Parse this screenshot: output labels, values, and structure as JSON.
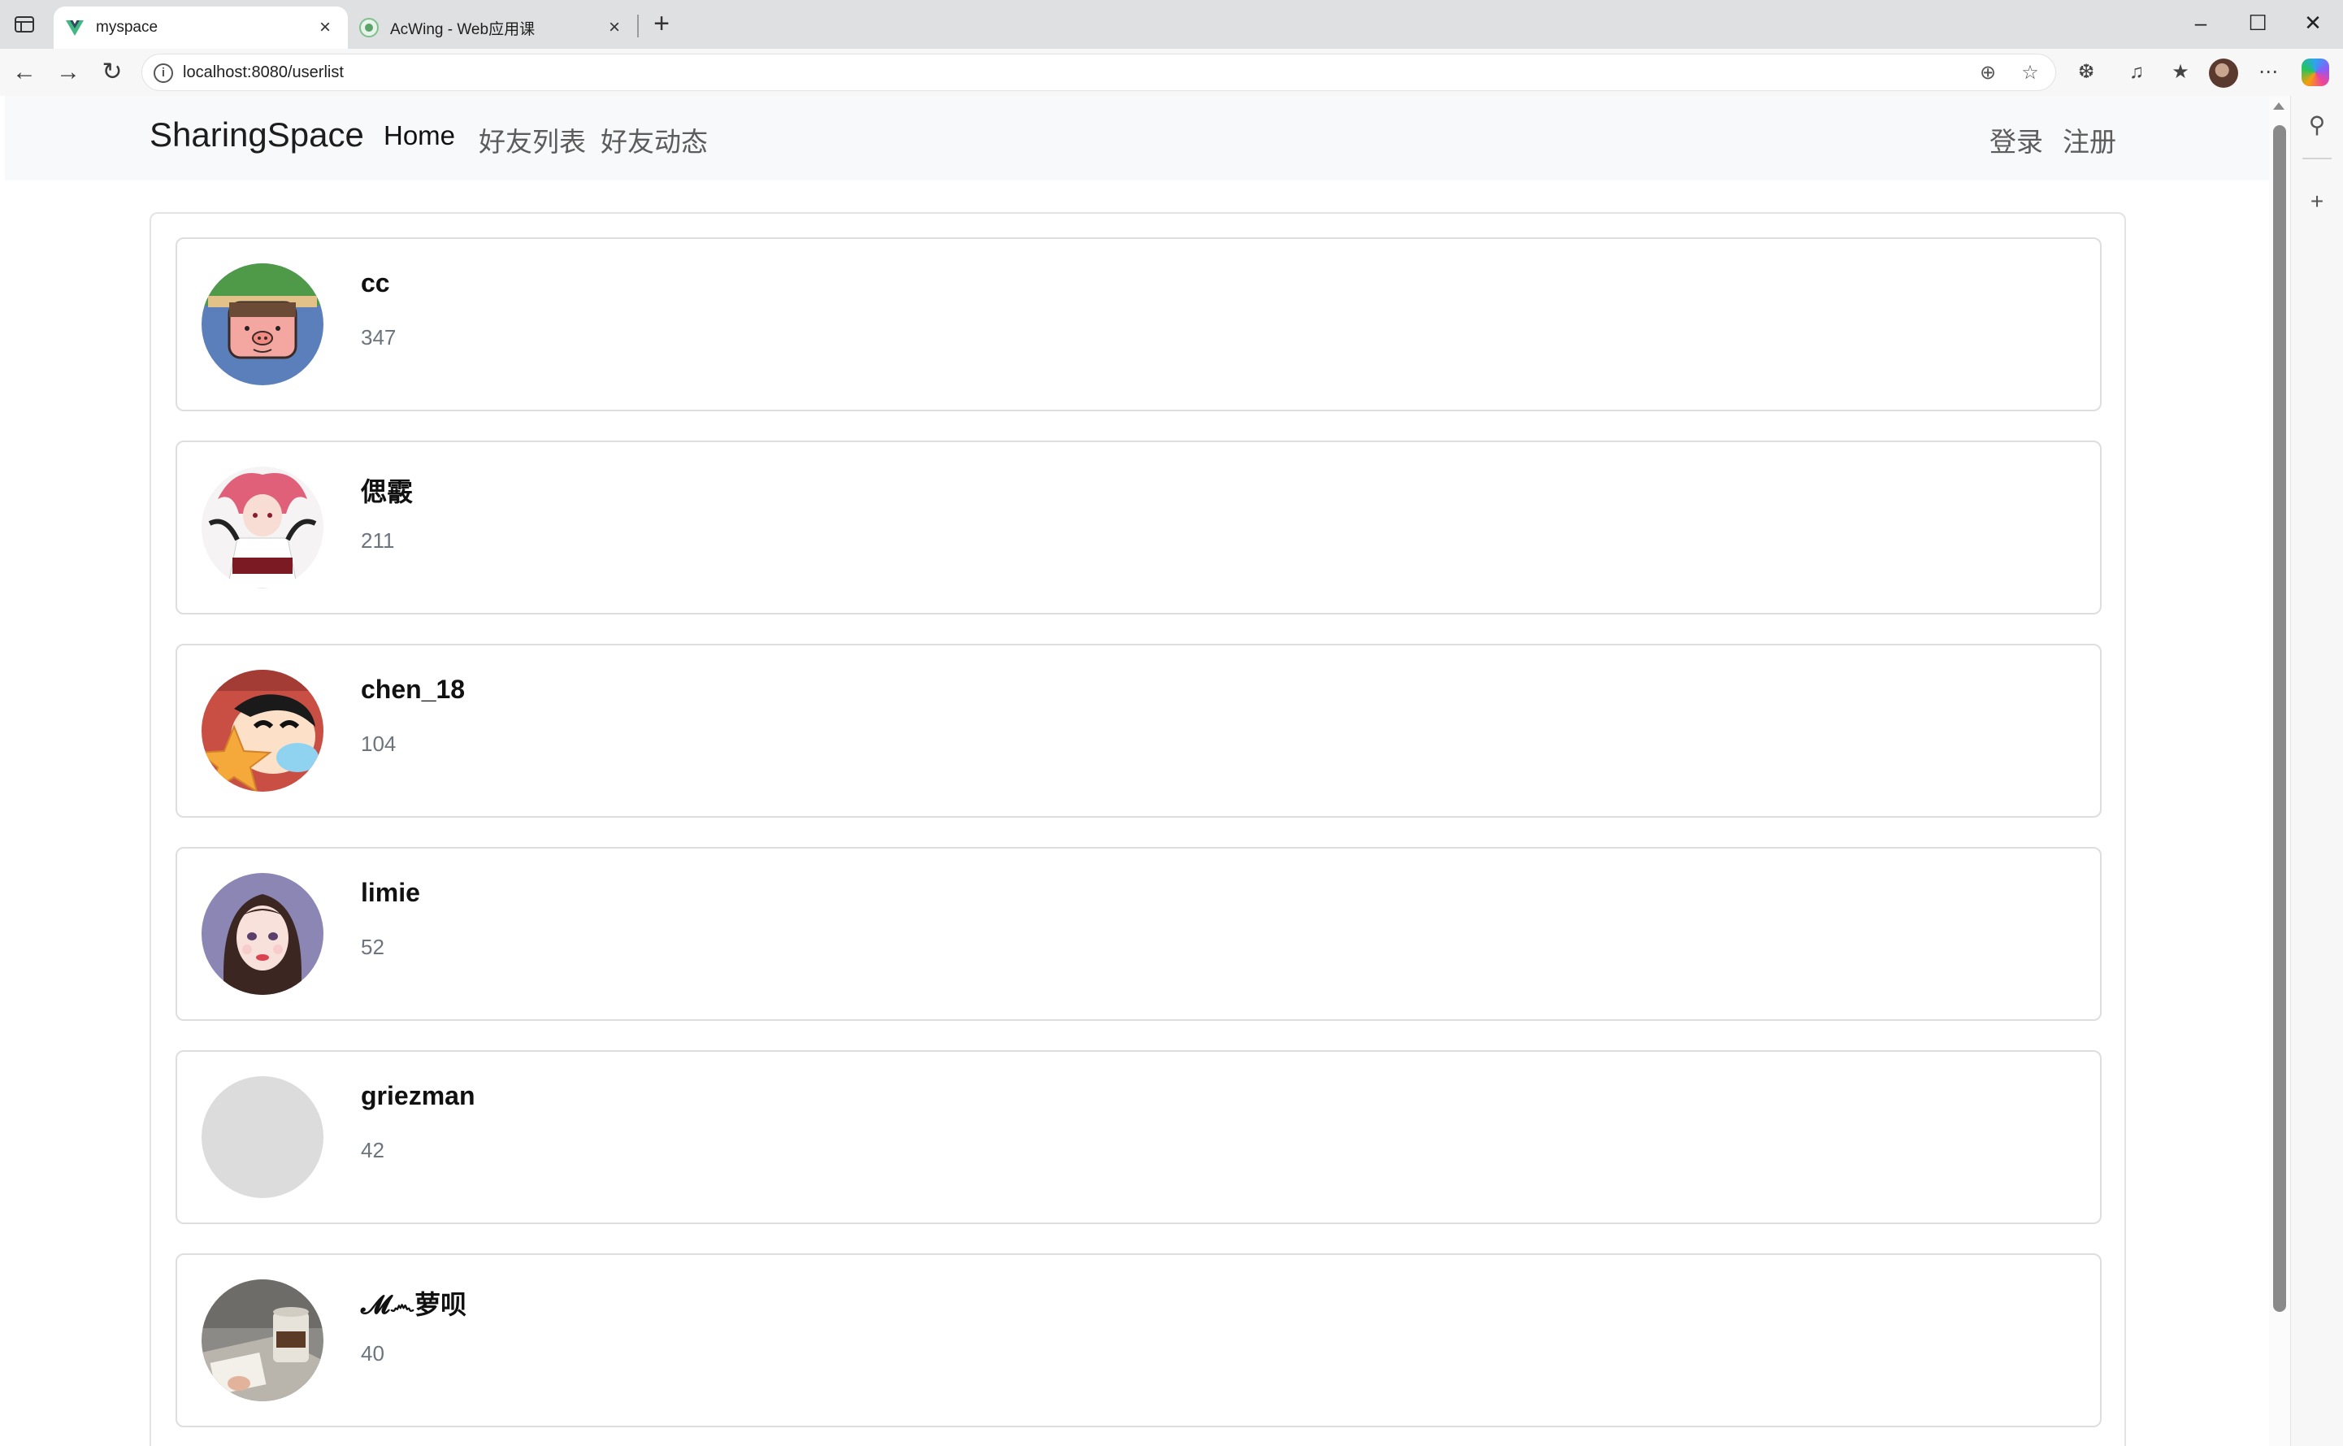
{
  "browser": {
    "tabs": [
      {
        "title": "myspace",
        "active": true
      },
      {
        "title": "AcWing - Web应用课",
        "active": false
      }
    ],
    "url": "localhost:8080/userlist"
  },
  "navbar": {
    "brand": "SharingSpace",
    "links": [
      "Home",
      "好友列表",
      "好友动态"
    ],
    "right_links": [
      "登录",
      "注册"
    ]
  },
  "users": [
    {
      "username": "cc",
      "followers": "347",
      "avatar": "cartoon-pig"
    },
    {
      "username": "偲霰",
      "followers": "211",
      "avatar": "anime-girl"
    },
    {
      "username": "chen_18",
      "followers": "104",
      "avatar": "crayon-shin-chan"
    },
    {
      "username": "limie",
      "followers": "52",
      "avatar": "illustrated-girl"
    },
    {
      "username": "griezman",
      "followers": "42",
      "avatar": "empty"
    },
    {
      "username": "𝓜෴萝呗",
      "followers": "40",
      "avatar": "coffee-desk-photo"
    }
  ],
  "colors": {
    "navbar_bg": "#f8f9fa",
    "card_border": "#dedede",
    "muted_text": "#6c757d",
    "tabbar_bg": "#dfe0e2"
  }
}
